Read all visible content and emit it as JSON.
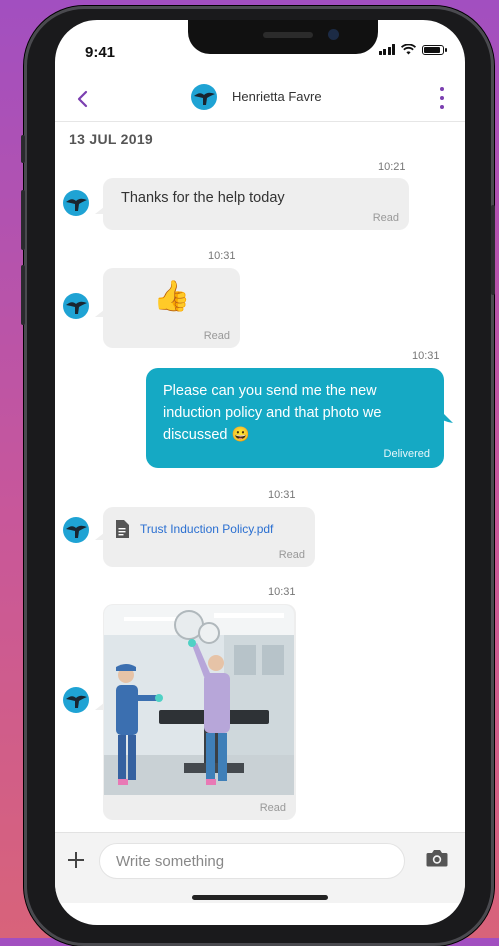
{
  "status_bar": {
    "time": "9:41"
  },
  "header": {
    "contact_name": "Henrietta Favre"
  },
  "date_separator": "13 JUL 2019",
  "messages": [
    {
      "direction": "in",
      "time": "10:21",
      "text": "Thanks for the help today",
      "status": "Read"
    },
    {
      "direction": "in",
      "time": "10:31",
      "emoji": "👍",
      "status": "Read"
    },
    {
      "direction": "out",
      "time": "10:31",
      "text": "Please can you send me the new induction policy and that photo we discussed 😀",
      "status": "Delivered"
    },
    {
      "direction": "in",
      "time": "10:31",
      "file_name": "Trust Induction Policy.pdf",
      "status": "Read"
    },
    {
      "direction": "in",
      "time": "10:31",
      "image": "operating-room-photo",
      "status": "Read"
    }
  ],
  "composer": {
    "placeholder": "Write something"
  },
  "colors": {
    "accent": "#7b3fb0",
    "outgoing_bubble": "#15a9c4",
    "incoming_bubble": "#eeeeee",
    "link": "#2a6fd1"
  }
}
